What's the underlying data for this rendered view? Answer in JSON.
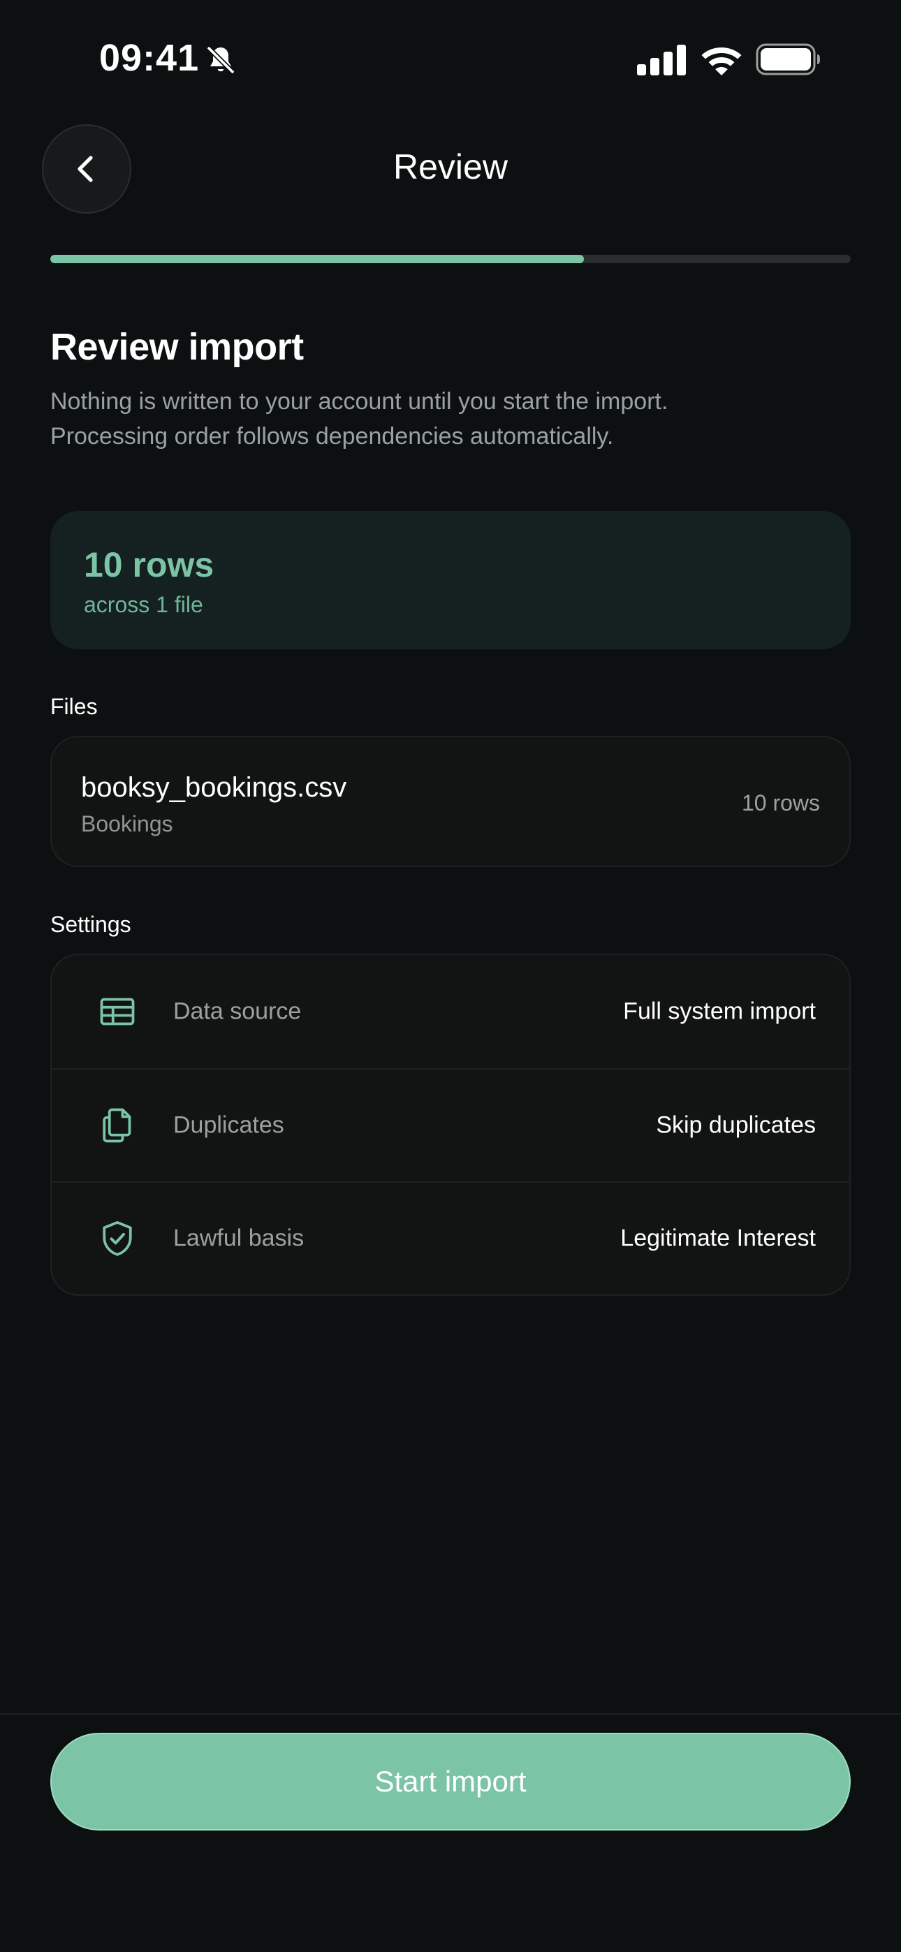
{
  "status_bar": {
    "time": "09:41"
  },
  "header": {
    "title": "Review"
  },
  "progress": {
    "fraction": 0.667
  },
  "review": {
    "heading": "Review import",
    "description_line1": "Nothing is written to your account until you start the import.",
    "description_line2": "Processing order follows dependencies automatically."
  },
  "summary": {
    "count": "10 rows",
    "subtitle": "across 1 file"
  },
  "files": {
    "label": "Files",
    "items": [
      {
        "name": "booksy_bookings.csv",
        "type": "Bookings",
        "rows": "10 rows"
      }
    ]
  },
  "settings": {
    "label": "Settings",
    "items": [
      {
        "icon": "table-icon",
        "label": "Data source",
        "value": "Full system import"
      },
      {
        "icon": "documents-icon",
        "label": "Duplicates",
        "value": "Skip duplicates"
      },
      {
        "icon": "shield-check-icon",
        "label": "Lawful basis",
        "value": "Legitimate Interest"
      }
    ]
  },
  "footer": {
    "start_label": "Start import"
  },
  "colors": {
    "accent": "#7cc4a6",
    "background": "#0c1010",
    "card": "#121414"
  }
}
